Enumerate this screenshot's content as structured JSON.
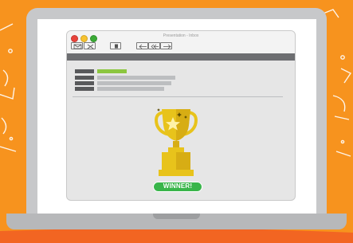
{
  "colors": {
    "background": "#f7931e",
    "laptop": "#c7c8ca",
    "window": "#e6e6e6",
    "toolbar_strip": "#6d6e71",
    "accent": "#8cc63f",
    "trophy": "#e8c31b",
    "badge": "#39b54a"
  },
  "window": {
    "title": "Presentation - Inbox",
    "traffic_lights": [
      "#e8423a",
      "#f7c22e",
      "#3aaa35"
    ]
  },
  "toolbar": {
    "buttons": [
      "compose-icon",
      "delete-icon",
      "archive-icon",
      "reply-icon",
      "reply-all-icon",
      "forward-icon"
    ]
  },
  "trophy": {
    "icon": "trophy-icon",
    "badge_label": "WINNER!"
  }
}
